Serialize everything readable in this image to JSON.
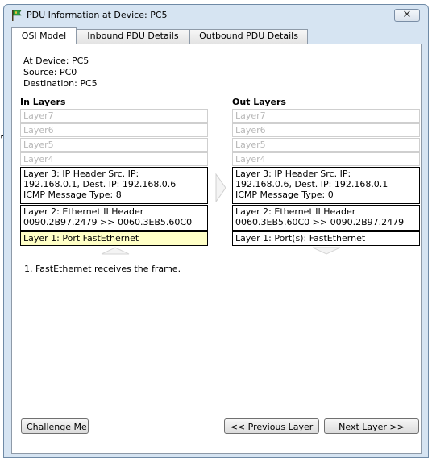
{
  "window": {
    "title": "PDU Information at Device: PC5",
    "close_glyph": "✕"
  },
  "tabs": [
    {
      "label": "OSI Model",
      "active": true
    },
    {
      "label": "Inbound PDU Details",
      "active": false
    },
    {
      "label": "Outbound PDU Details",
      "active": false
    }
  ],
  "device_info": {
    "at_device": "At Device: PC5",
    "source": "Source: PC0",
    "destination": "Destination: PC5"
  },
  "in_layers": {
    "header": "In Layers",
    "layer7": "Layer7",
    "layer6": "Layer6",
    "layer5": "Layer5",
    "layer4": "Layer4",
    "layer3": [
      "Layer 3: IP Header Src. IP:",
      "192.168.0.1, Dest. IP: 192.168.0.6",
      "ICMP Message Type: 8"
    ],
    "layer2": [
      "Layer 2: Ethernet II Header",
      "0090.2B97.2479 >> 0060.3EB5.60C0"
    ],
    "layer1": "Layer 1: Port FastEthernet"
  },
  "out_layers": {
    "header": "Out Layers",
    "layer7": "Layer7",
    "layer6": "Layer6",
    "layer5": "Layer5",
    "layer4": "Layer4",
    "layer3": [
      "Layer 3: IP Header Src. IP:",
      "192.168.0.6, Dest. IP: 192.168.0.1",
      "ICMP Message Type: 0"
    ],
    "layer2": [
      "Layer 2: Ethernet II Header",
      "0060.3EB5.60C0 >> 0090.2B97.2479"
    ],
    "layer1": "Layer 1: Port(s): FastEthernet"
  },
  "description": "1. FastEthernet receives the frame.",
  "buttons": {
    "challenge": "Challenge Me",
    "previous": "<< Previous Layer",
    "next": "Next Layer >>"
  },
  "colors": {
    "highlight": "#ffffc6",
    "window_bg": "#d6e4f2"
  }
}
